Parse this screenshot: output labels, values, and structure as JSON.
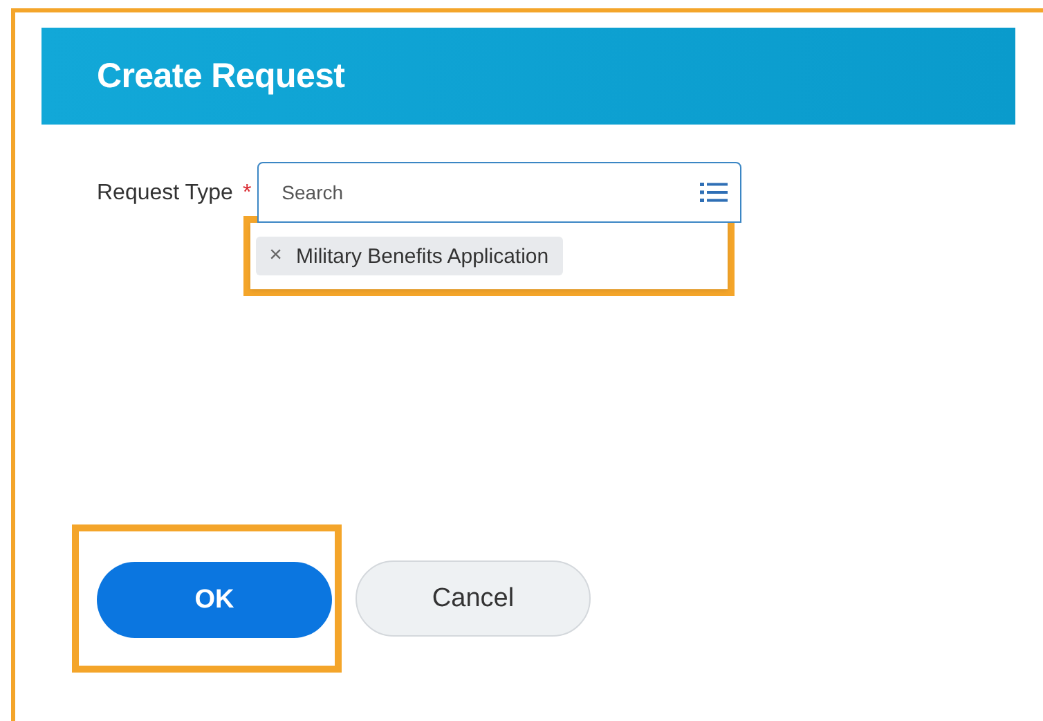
{
  "dialog": {
    "title": "Create Request"
  },
  "field": {
    "label": "Request Type",
    "required": true,
    "required_mark": "*",
    "placeholder": "Search",
    "selection": {
      "highlighted": true,
      "items": [
        {
          "remove": "×",
          "label": "Military Benefits Application"
        }
      ]
    }
  },
  "buttons": [
    {
      "label": "OK",
      "kind": "primary",
      "highlighted": true
    },
    {
      "label": "Cancel",
      "kind": "secondary",
      "highlighted": false
    }
  ]
}
